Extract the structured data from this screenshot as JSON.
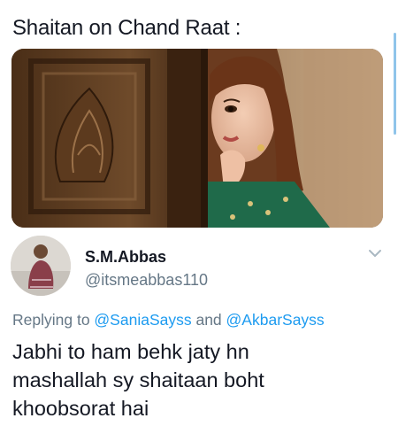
{
  "quoted": {
    "title": "Shaitan on Chand Raat :"
  },
  "media": {
    "image_description_icon": "photo-woman-peeking-behind-door"
  },
  "tweet": {
    "author": {
      "display_name": "S.M.Abbas",
      "handle": "@itsmeabbas110"
    },
    "replying": {
      "prefix": "Replying to ",
      "mention_1": "@SaniaSayss",
      "connector": " and ",
      "mention_2": "@AkbarSayss"
    },
    "text_lines": [
      "Jabhi to ham behk jaty hn",
      "mashallah sy shaitaan boht",
      "khoobsorat hai"
    ]
  },
  "colors": {
    "text": "#141823",
    "secondary": "#657786",
    "link": "#1d9bf0"
  }
}
